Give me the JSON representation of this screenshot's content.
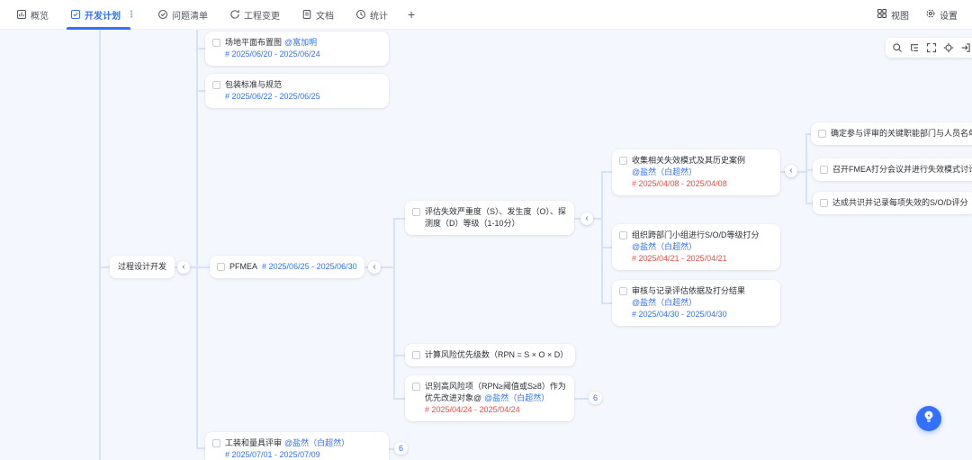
{
  "tabbar": {
    "tabs": [
      {
        "label": "概览",
        "icon": "overview-icon",
        "active": false
      },
      {
        "label": "开发计划",
        "icon": "plan-checklist-icon",
        "active": true
      },
      {
        "label": "问题清单",
        "icon": "issue-list-icon",
        "active": false
      },
      {
        "label": "工程变更",
        "icon": "engineering-change-icon",
        "active": false
      },
      {
        "label": "文档",
        "icon": "document-icon",
        "active": false
      },
      {
        "label": "统计",
        "icon": "statistics-icon",
        "active": false
      }
    ],
    "add_label": "+",
    "more_dots": "⋮",
    "right": {
      "view_label": "视图",
      "view_icon": "grid-view-icon",
      "settings_label": "设置",
      "settings_icon": "gear-icon"
    }
  },
  "map_toolbar_icons": [
    "search-icon",
    "outline-tree-icon",
    "fit-screen-icon",
    "locate-center-icon",
    "exit-view-icon"
  ],
  "help_icon": "lightbulb-icon",
  "root": {
    "label": "过程设计开发"
  },
  "collapse_chevron": "‹",
  "nodes": [
    {
      "title": "场地平面布置图",
      "mention": "@富加明",
      "date": "# 2025/06/20 - 2025/06/24",
      "date_color": "date-blue"
    },
    {
      "title": "包装标准与规范",
      "date": "# 2025/06/22 - 2025/06/25",
      "date_color": "date-blue"
    },
    {
      "title": "PFMEA",
      "date": "# 2025/06/25 - 2025/06/30",
      "date_color": "date-blue"
    },
    {
      "title": "工装和量具评审",
      "mention": "@盐然（白超然）",
      "date": "# 2025/07/01 - 2025/07/09",
      "date_color": "date-blue"
    },
    {
      "title": "评估失效严重度（S）、发生度（O）、探测度（D）等级（1-10分）"
    },
    {
      "title": "计算风险优先级数（RPN = S × O × D）"
    },
    {
      "title": "识别高风险项（RPN≥阈值或S≥8）作为优先改进对象@",
      "mention": "@盐然（白超然）",
      "date": "# 2025/04/24 - 2025/04/24",
      "date_color": "date-red"
    },
    {
      "title": "收集相关失效模式及其历史案例",
      "mention": "@盐然（白超然）",
      "date": "# 2025/04/08 - 2025/04/08",
      "date_color": "date-red"
    },
    {
      "title": "组织跨部门小组进行S/O/D等级打分",
      "mention": "@盐然（白超然）",
      "date": "# 2025/04/21 - 2025/04/21",
      "date_color": "date-red"
    },
    {
      "title": "审核与记录评估依据及打分结果",
      "mention": "@盐然（白超然）",
      "date": "# 2025/04/30 - 2025/04/30",
      "date_color": "date-blue"
    },
    {
      "title": "确定参与评审的关键职能部门与人员名单"
    },
    {
      "title": "召开FMEA打分会议并进行失效模式讨论"
    },
    {
      "title": "达成共识并记录每项失效的S/O/D评分"
    }
  ],
  "badges": [
    {
      "count": "6"
    },
    {
      "count": "6"
    }
  ],
  "colors": {
    "accent": "#3370ff",
    "date_blue": "#3370ff",
    "date_red": "#f54a45",
    "canvas_bg": "#f4f7fd",
    "connector": "#d5e3fa"
  }
}
